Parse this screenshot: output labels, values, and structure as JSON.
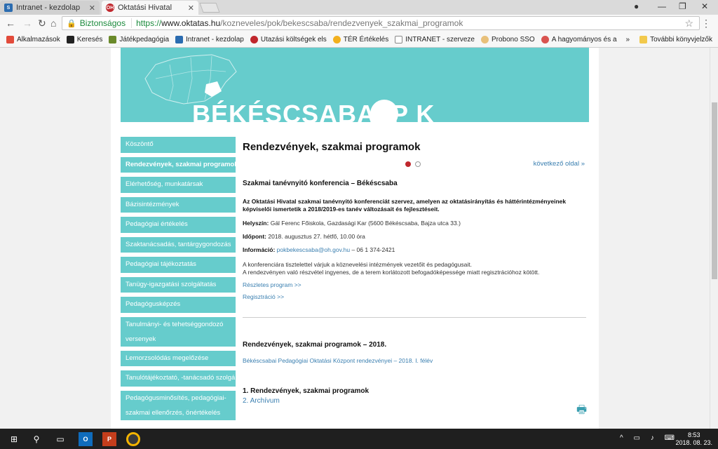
{
  "browser": {
    "tabs": [
      {
        "label": "Intranet - kezdolap",
        "icon": "sharepoint-icon"
      },
      {
        "label": "Oktatási Hivatal",
        "icon": "oh-icon"
      }
    ],
    "secure_label": "Biztonságos",
    "url_scheme": "https://",
    "url_host": "www.oktatas.hu",
    "url_path": "/kozneveles/pok/bekescsaba/rendezvenyek_szakmai_programok",
    "bookmarks": [
      {
        "label": "Alkalmazások",
        "color": "#e24b3b"
      },
      {
        "label": "Keresés",
        "color": "#222222"
      },
      {
        "label": "Játékpedagógia",
        "color": "#6a8a2a"
      },
      {
        "label": "Intranet - kezdolap",
        "color": "#2b6cb0"
      },
      {
        "label": "Utazási költségek els",
        "color": "#c0272d"
      },
      {
        "label": "TÉR Értékelés",
        "color": "#f2b01e"
      },
      {
        "label": "INTRANET - szerveze",
        "color": "#888888"
      },
      {
        "label": "Probono SSO",
        "color": "#e8c07a"
      },
      {
        "label": "A hagyományos és a",
        "color": "#d9534f"
      }
    ],
    "more_bookmarks": "»",
    "other_bookmarks": "További könyvjelzők"
  },
  "site": {
    "banner_title": "BÉKÉSCSABAI P  K",
    "sidebar": [
      {
        "label": "Köszöntő",
        "active": false
      },
      {
        "label": "Rendezvények, szakmai programok",
        "active": true
      },
      {
        "label": "Elérhetőség, munkatársak",
        "active": false
      },
      {
        "label": "Bázisintézmények",
        "active": false
      },
      {
        "label": "Pedagógiai értékelés",
        "active": false
      },
      {
        "label": "Szaktanácsadás, tantárgygondozás",
        "active": false
      },
      {
        "label": "Pedagógiai tájékoztatás",
        "active": false
      },
      {
        "label": "Tanügy-igazgatási szolgáltatás",
        "active": false
      },
      {
        "label": "Pedagógusképzés",
        "active": false
      },
      {
        "label": "Tanulmányi- és tehetséggondozó versenyek",
        "active": false
      },
      {
        "label": "Lemorzsolódás megelőzése",
        "active": false
      },
      {
        "label": "Tanulótájékoztató, -tanácsadó szolgálat",
        "active": false
      },
      {
        "label": "Pedagógusminősítés, pedagógiai-szakmai ellenőrzés, önértékelés",
        "active": false
      }
    ],
    "main": {
      "title": "Rendezvények, szakmai programok",
      "next_page": "következő oldal »",
      "event_title": "Szakmai tanévnyitó konferencia – Békéscsaba",
      "intro": "Az Oktatási Hivatal szakmai tanévnyitó konferenciát szervez, amelyen az oktatásirányítás és háttérintézményeinek képviselői ismertetik a 2018/2019-es tanév változásait és fejlesztéseit.",
      "venue_label": "Helyszín:",
      "venue_value": "Gál Ferenc Főiskola, Gazdasági Kar (5600 Békéscsaba, Bajza utca 33.)",
      "time_label": "Időpont:",
      "time_value": "2018. augusztus 27. hétfő, 10.00 óra",
      "info_label": "Információ:",
      "info_email": "pokbekescsaba@oh.gov.hu",
      "info_phone": "– 06 1 374-2421",
      "para1": "A konferenciára tisztelettel várjuk a köznevelési intézmények vezetőit és pedagógusait.",
      "para2": "A rendezvényen való részvétel ingyenes, de a terem korlátozott befogadóképessége miatt regisztrációhoz kötött.",
      "link_program": "Részletes program >>",
      "link_register": "Regisztráció >>",
      "section_title": "Rendezvények, szakmai programok – 2018.",
      "section_link": "Békéscsabai Pedagógiai Oktatási Központ rendezvényei – 2018. I. félév",
      "list_item1": "1. Rendezvények, szakmai programok",
      "list_item2": "2. Archívum"
    }
  },
  "taskbar": {
    "time": "8:53",
    "date": "2018. 08. 23."
  }
}
